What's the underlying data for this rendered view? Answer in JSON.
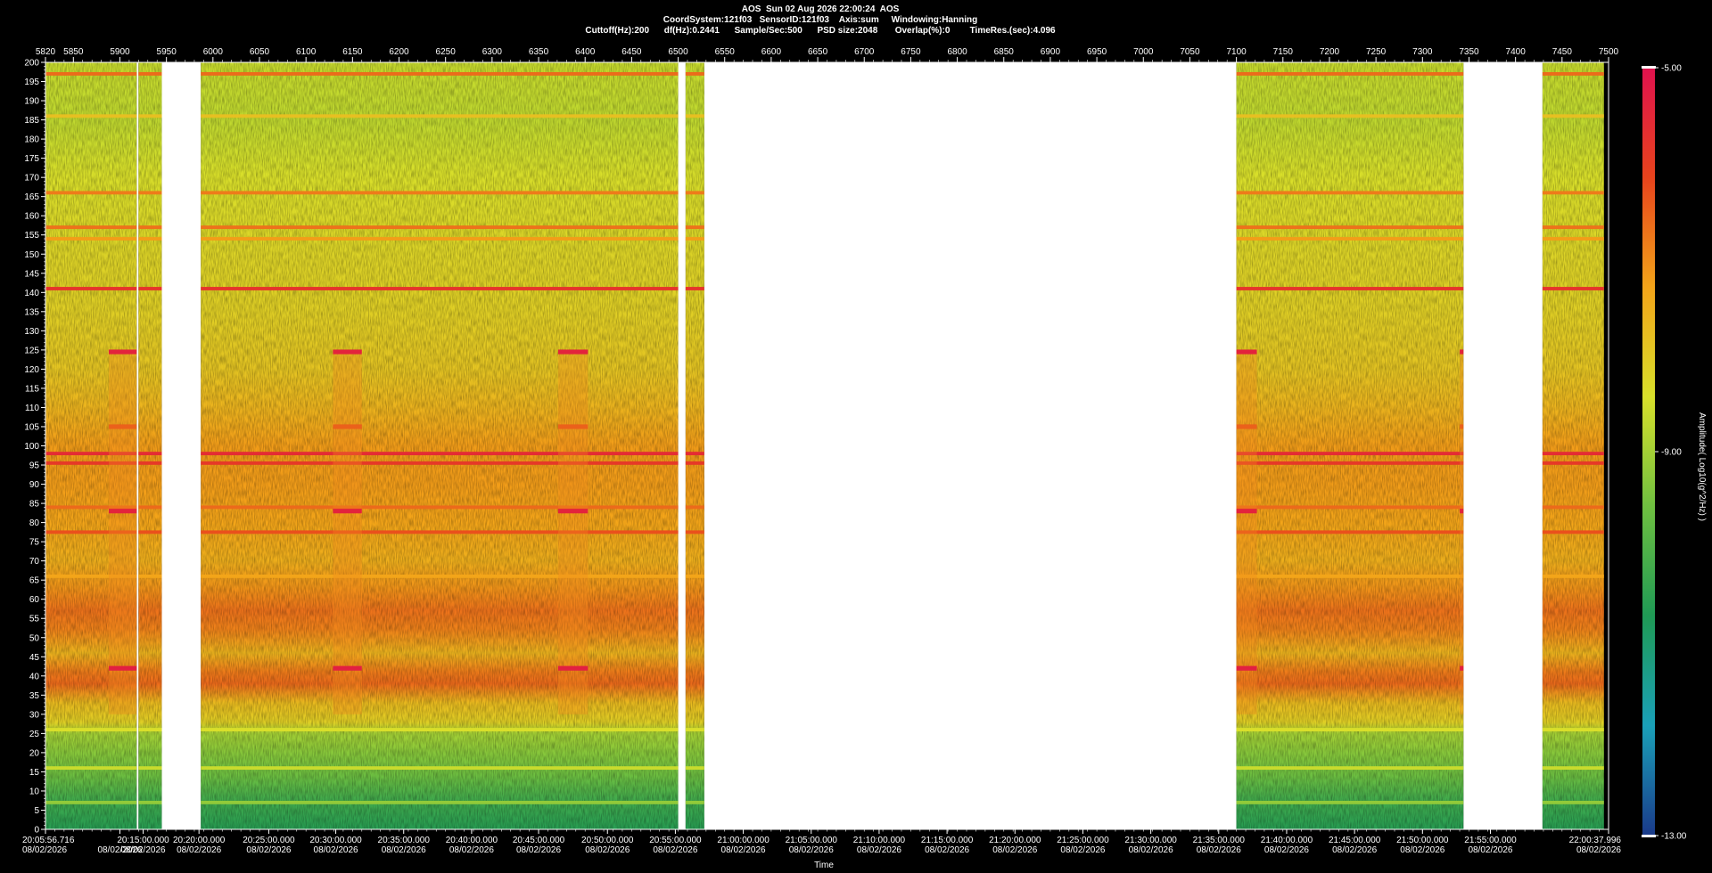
{
  "header": {
    "line1": "AOS  Sun 02 Aug 2026 22:00:24  AOS",
    "line2": "CoordSystem:121f03   SensorID:121f03    Axis:sum     Windowing:Hanning",
    "line3": "Cuttoff(Hz):200      df(Hz):0.2441      Sample/Sec:500      PSD size:2048       Overlap(%):0        TimeRes.(sec):4.096"
  },
  "chart_data": {
    "type": "heatmap",
    "title": "AOS  Sun 02 Aug 2026 22:00:24  AOS",
    "xlabel": "Time",
    "ylabel": "",
    "colorbar_label": "Amplitude( Log10(g^2/Hz) )",
    "colorbar_ticks": [
      "-5.00",
      "-9.00",
      "-13.00"
    ],
    "colorbar_range": [
      -13,
      -5
    ],
    "ylim": [
      0,
      200
    ],
    "y_ticks": [
      0,
      5,
      10,
      15,
      20,
      25,
      30,
      35,
      40,
      45,
      50,
      55,
      60,
      65,
      70,
      75,
      80,
      85,
      90,
      95,
      100,
      105,
      110,
      115,
      120,
      125,
      130,
      135,
      140,
      145,
      150,
      155,
      160,
      165,
      170,
      175,
      180,
      185,
      190,
      195,
      200
    ],
    "top_axis_range": [
      5820,
      7500
    ],
    "top_axis_ticks": [
      5820,
      5850,
      5900,
      5950,
      6000,
      6050,
      6100,
      6150,
      6200,
      6250,
      6300,
      6350,
      6400,
      6450,
      6500,
      6550,
      6600,
      6650,
      6700,
      6750,
      6800,
      6850,
      6900,
      6950,
      7000,
      7050,
      7100,
      7150,
      7200,
      7250,
      7300,
      7350,
      7400,
      7450,
      7500
    ],
    "x_ticks": [
      {
        "v": 5820,
        "label": "20:05:56.716",
        "date": "08/02/2026"
      },
      {
        "v": 5900,
        "label": "",
        "date": "08/02/2026"
      },
      {
        "v": 5925,
        "label": "20:15:00.000",
        "date": "08/02/2026"
      },
      {
        "v": 5985,
        "label": "20:20:00.000",
        "date": "08/02/2026"
      },
      {
        "v": 6060,
        "label": "20:25:00.000",
        "date": "08/02/2026"
      },
      {
        "v": 6132,
        "label": "20:30:00.000",
        "date": "08/02/2026"
      },
      {
        "v": 6205,
        "label": "20:35:00.000",
        "date": "08/02/2026"
      },
      {
        "v": 6278,
        "label": "20:40:00.000",
        "date": "08/02/2026"
      },
      {
        "v": 6350,
        "label": "20:45:00.000",
        "date": "08/02/2026"
      },
      {
        "v": 6424,
        "label": "20:50:00.000",
        "date": "08/02/2026"
      },
      {
        "v": 6497,
        "label": "20:55:00.000",
        "date": "08/02/2026"
      },
      {
        "v": 6570,
        "label": "21:00:00.000",
        "date": "08/02/2026"
      },
      {
        "v": 6643,
        "label": "21:05:00.000",
        "date": "08/02/2026"
      },
      {
        "v": 6716,
        "label": "21:10:00.000",
        "date": "08/02/2026"
      },
      {
        "v": 6789,
        "label": "21:15:00.000",
        "date": "08/02/2026"
      },
      {
        "v": 6862,
        "label": "21:20:00.000",
        "date": "08/02/2026"
      },
      {
        "v": 6935,
        "label": "21:25:00.000",
        "date": "08/02/2026"
      },
      {
        "v": 7008,
        "label": "21:30:00.000",
        "date": "08/02/2026"
      },
      {
        "v": 7081,
        "label": "21:35:00.000",
        "date": "08/02/2026"
      },
      {
        "v": 7154,
        "label": "21:40:00.000",
        "date": "08/02/2026"
      },
      {
        "v": 7227,
        "label": "21:45:00.000",
        "date": "08/02/2026"
      },
      {
        "v": 7300,
        "label": "21:50:00.000",
        "date": "08/02/2026"
      },
      {
        "v": 7373,
        "label": "21:55:00.000",
        "date": "08/02/2026"
      },
      {
        "v": 7500,
        "label": "22:00:37.996",
        "date": "08/02/2026"
      }
    ],
    "data_segments": [
      [
        5820,
        5918
      ],
      [
        5920,
        5945
      ],
      [
        5987,
        6500
      ],
      [
        6508,
        6528
      ],
      [
        7100,
        7344
      ],
      [
        7429,
        7495
      ]
    ],
    "gaps": [
      [
        5918,
        5920
      ],
      [
        5945,
        5987
      ],
      [
        6500,
        6508
      ],
      [
        6528,
        7100
      ],
      [
        7344,
        7429
      ]
    ],
    "bursts": [
      [
        5888,
        5918
      ],
      [
        6129,
        6160
      ],
      [
        6371,
        6403
      ],
      [
        7100,
        7122
      ],
      [
        7340,
        7344
      ]
    ],
    "color_stops": [
      "#1a3a8a",
      "#1aa0b8",
      "#1f9a55",
      "#6fc040",
      "#d8e02a",
      "#f3a419",
      "#e8431c",
      "#e0124e"
    ],
    "bands": [
      {
        "freq": 197,
        "amp": -6.6
      },
      {
        "freq": 186,
        "amp": -7.8
      },
      {
        "freq": 166,
        "amp": -6.8
      },
      {
        "freq": 157,
        "amp": -6.7
      },
      {
        "freq": 154,
        "amp": -7.2
      },
      {
        "freq": 141,
        "amp": -5.8
      },
      {
        "freq": 98,
        "amp": -5.6
      },
      {
        "freq": 95.5,
        "amp": -5.9
      },
      {
        "freq": 84,
        "amp": -6.6
      },
      {
        "freq": 77.5,
        "amp": -6.3
      },
      {
        "freq": 66,
        "amp": -7.3
      },
      {
        "freq": 26,
        "amp": -8.4
      },
      {
        "freq": 16,
        "amp": -8.6
      },
      {
        "freq": 7,
        "amp": -9.2
      }
    ],
    "burst_bands": [
      {
        "freq": 124.5,
        "amp": -5.4
      },
      {
        "freq": 83,
        "amp": -5.4
      },
      {
        "freq": 42,
        "amp": -5.3
      },
      {
        "freq": 105,
        "amp": -6.5
      }
    ],
    "profile": [
      {
        "f": 0,
        "amp": -10.6
      },
      {
        "f": 8,
        "amp": -10.2
      },
      {
        "f": 14,
        "amp": -9.6
      },
      {
        "f": 20,
        "amp": -9.3
      },
      {
        "f": 25,
        "amp": -9.0
      },
      {
        "f": 28,
        "amp": -8.1
      },
      {
        "f": 33,
        "amp": -7.7
      },
      {
        "f": 38,
        "amp": -6.6
      },
      {
        "f": 41,
        "amp": -6.8
      },
      {
        "f": 46,
        "amp": -7.6
      },
      {
        "f": 52,
        "amp": -6.9
      },
      {
        "f": 57,
        "amp": -6.7
      },
      {
        "f": 63,
        "amp": -7.1
      },
      {
        "f": 70,
        "amp": -7.5
      },
      {
        "f": 80,
        "amp": -7.3
      },
      {
        "f": 90,
        "amp": -7.2
      },
      {
        "f": 100,
        "amp": -7.2
      },
      {
        "f": 110,
        "amp": -7.6
      },
      {
        "f": 120,
        "amp": -7.9
      },
      {
        "f": 135,
        "amp": -8.1
      },
      {
        "f": 150,
        "amp": -8.2
      },
      {
        "f": 170,
        "amp": -8.4
      },
      {
        "f": 185,
        "amp": -8.7
      },
      {
        "f": 200,
        "amp": -8.6
      }
    ]
  }
}
